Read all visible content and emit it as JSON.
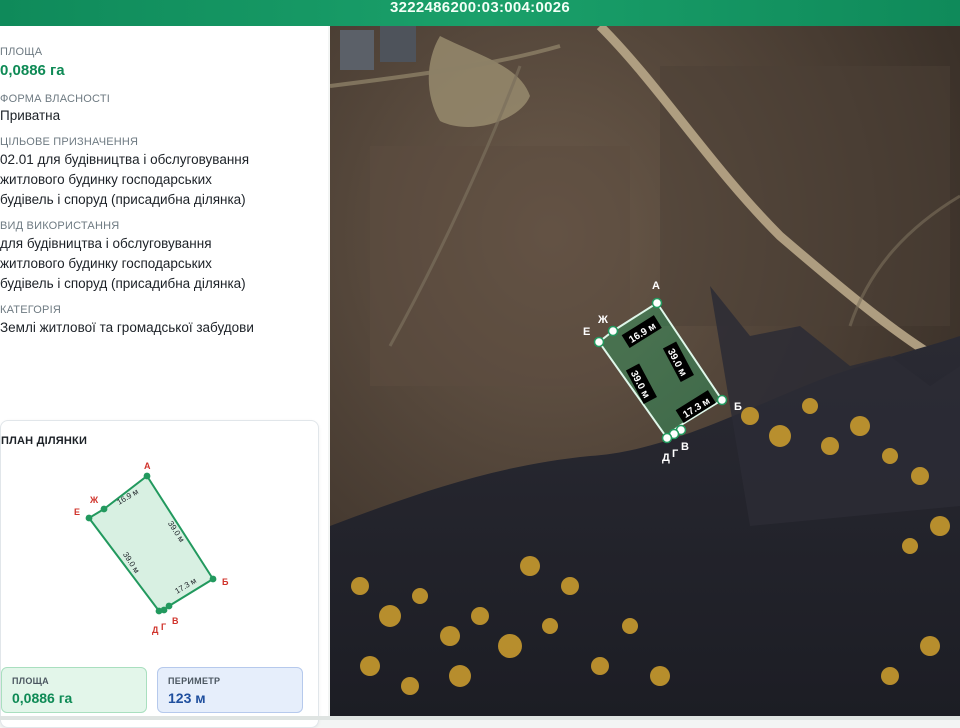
{
  "header": {
    "cadastral_number": "3222486200:03:004:0026"
  },
  "info": {
    "area": {
      "label": "ПЛОЩА",
      "value": "0,0886 га"
    },
    "ownership": {
      "label": "ФОРМА ВЛАСНОСТІ",
      "value": "Приватна"
    },
    "purpose": {
      "label": "ЦІЛЬОВЕ ПРИЗНАЧЕННЯ",
      "lines": [
        "02.01 для будівництва і обслуговування",
        "житлового будинку господарських",
        "будівель і споруд (присадибна ділянка)"
      ]
    },
    "usage": {
      "label": "ВИД ВИКОРИСТАННЯ",
      "lines": [
        "для будівництва і обслуговування",
        "житлового будинку господарських",
        "будівель і споруд (присадибна ділянка)"
      ]
    },
    "category": {
      "label": "КАТЕГОРІЯ",
      "value": "Землі житлової та громадської забудови"
    }
  },
  "plan": {
    "title": "ПЛАН ДІЛЯНКИ",
    "vertices": [
      "А",
      "Б",
      "В",
      "Г",
      "Д",
      "Е",
      "Ж"
    ],
    "edge_labels": {
      "top": "16.9 м",
      "right": "39.0 м",
      "left": "39.0 м",
      "bottom": "17.3 м"
    }
  },
  "stats": {
    "area": {
      "label": "ПЛОЩА",
      "value": "0,0886 га"
    },
    "perimeter": {
      "label": "ПЕРИМЕТР",
      "value": "123 м"
    }
  },
  "colors": {
    "accent": "#0e8a55",
    "parcel_fill": "#22b46e",
    "vertex_label_plan": "#d0332b"
  }
}
